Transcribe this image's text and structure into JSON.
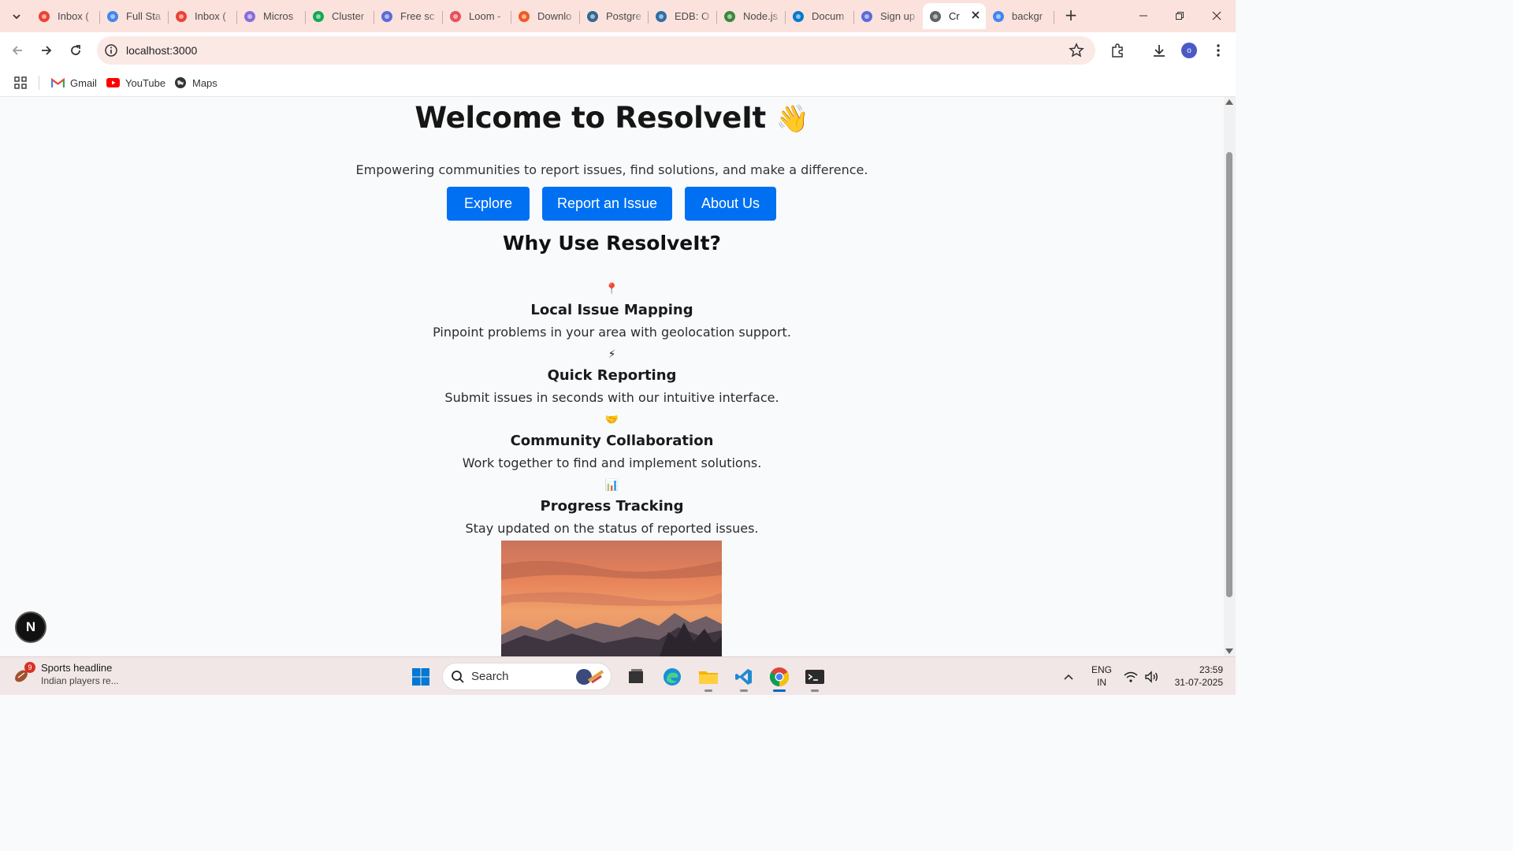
{
  "browser": {
    "tabs": [
      {
        "title": "Inbox (",
        "icon": "gmail-icon",
        "color": "#ea4335"
      },
      {
        "title": "Full Sta",
        "icon": "docs-icon",
        "color": "#4285f4"
      },
      {
        "title": "Inbox (",
        "icon": "gmail-icon",
        "color": "#ea4335"
      },
      {
        "title": "Micros",
        "icon": "copilot-icon",
        "color": "#8a6cd8"
      },
      {
        "title": "Cluster",
        "icon": "mongodb-icon",
        "color": "#13aa52"
      },
      {
        "title": "Free sc",
        "icon": "snowflake-icon",
        "color": "#5b6bd8"
      },
      {
        "title": "Loom -",
        "icon": "loom-icon",
        "color": "#e8505b"
      },
      {
        "title": "Downlo",
        "icon": "download-site-icon",
        "color": "#f15a24"
      },
      {
        "title": "Postgre",
        "icon": "postgres-icon",
        "color": "#336791"
      },
      {
        "title": "EDB: O",
        "icon": "edb-icon",
        "color": "#2f6ea5"
      },
      {
        "title": "Node.js",
        "icon": "nodejs-icon",
        "color": "#3c873a"
      },
      {
        "title": "Docum",
        "icon": "vscode-icon",
        "color": "#007acc"
      },
      {
        "title": "Sign up",
        "icon": "snowflake-icon",
        "color": "#5b6bd8"
      },
      {
        "title": "Cr",
        "icon": "globe-icon",
        "color": "#5f6368",
        "active": true
      },
      {
        "title": "backgr",
        "icon": "google-icon",
        "color": "#4285f4"
      }
    ],
    "new_tab_label": "+",
    "url": "localhost:3000",
    "bookmarks": [
      {
        "label": "Gmail",
        "icon": "gmail-icon"
      },
      {
        "label": "YouTube",
        "icon": "youtube-icon"
      },
      {
        "label": "Maps",
        "icon": "maps-icon"
      }
    ],
    "profile_initial": "o"
  },
  "page": {
    "title": "Welcome to ResolveIt",
    "title_emoji": "👋",
    "tagline": "Empowering communities to report issues, find solutions, and make a difference.",
    "buttons": {
      "explore": "Explore",
      "report": "Report an Issue",
      "about": "About Us"
    },
    "why_title": "Why Use ResolveIt?",
    "features": [
      {
        "icon": "📍",
        "title": "Local Issue Mapping",
        "desc": "Pinpoint problems in your area with geolocation support."
      },
      {
        "icon": "⚡",
        "title": "Quick Reporting",
        "desc": "Submit issues in seconds with our intuitive interface."
      },
      {
        "icon": "🤝",
        "title": "Community Collaboration",
        "desc": "Work together to find and implement solutions."
      },
      {
        "icon": "📊",
        "title": "Progress Tracking",
        "desc": "Stay updated on the status of reported issues."
      }
    ],
    "accent_color": "#0070f3",
    "badge_letter": "N"
  },
  "taskbar": {
    "weather_badge": "9",
    "weather_title": "Sports headline",
    "weather_sub": "Indian players re...",
    "search_label": "Search",
    "lang_line1": "ENG",
    "lang_line2": "IN",
    "time": "23:59",
    "date": "31-07-2025"
  }
}
